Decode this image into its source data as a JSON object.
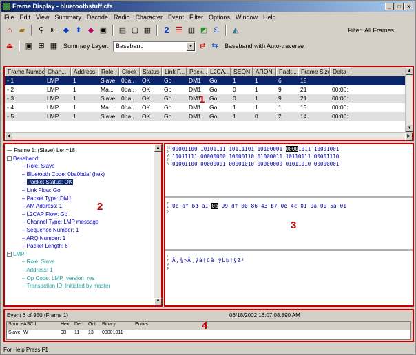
{
  "window": {
    "title": "Frame Display - bluetoothstuff.cfa",
    "min": "_",
    "max": "□",
    "close": "×"
  },
  "menu": [
    "File",
    "Edit",
    "View",
    "Summary",
    "Decode",
    "Radio",
    "Character",
    "Event",
    "Filter",
    "Options",
    "Window",
    "Help"
  ],
  "toolbar": {
    "filter_label": "Filter: All Frames",
    "summary_label": "Summary Layer:",
    "summary_value": "Baseband",
    "auto_label": "Baseband with Auto-traverse"
  },
  "summary": {
    "columns": [
      "Frame Number",
      "Chan...",
      "Address",
      "Role",
      "Clock",
      "Status",
      "Link F...",
      "Pack...",
      "L2CA...",
      "SEQN",
      "ARQN",
      "Pack...",
      "Frame Size",
      "Delta"
    ],
    "rows": [
      [
        "1",
        "LMP",
        "1",
        "Slave",
        "0ba..",
        "OK",
        "Go",
        "DM1",
        "Go",
        "1",
        "1",
        "6",
        "18",
        ""
      ],
      [
        "2",
        "LMP",
        "1",
        "Ma...",
        "0ba..",
        "OK",
        "Go",
        "DM1",
        "Go",
        "0",
        "1",
        "9",
        "21",
        "00:00:"
      ],
      [
        "3",
        "LMP",
        "1",
        "Slave",
        "0ba..",
        "OK",
        "Go",
        "DM1",
        "Go",
        "0",
        "1",
        "9",
        "21",
        "00:00:"
      ],
      [
        "4",
        "LMP",
        "1",
        "Ma...",
        "0ba..",
        "OK",
        "Go",
        "DM1",
        "Go",
        "1",
        "1",
        "1",
        "13",
        "00:00:"
      ],
      [
        "5",
        "LMP",
        "1",
        "Slave",
        "0ba..",
        "OK",
        "Go",
        "DM1",
        "Go",
        "1",
        "0",
        "2",
        "14",
        "00:00:"
      ]
    ]
  },
  "decode": {
    "frame": "Frame 1: (Slave) Len=18",
    "baseband": "Baseband:",
    "bb_items": [
      "Role: Slave",
      "Bluetooth Code: 0ba0bdaf (hex)",
      "Packet Status: OK",
      "Link Flow: Go",
      "Packet Type: DM1",
      "AM Address: 1",
      "L2CAP Flow: Go",
      "Channel Type: LMP message",
      "Sequence Number: 1",
      "ARQ Number: 1",
      "Packet Length: 6"
    ],
    "lmp": "LMP:",
    "lmp_items": [
      "Role: Slave",
      "Address: 1",
      "Op Code: LMP_version_res",
      "Transaction ID: Initiated by master"
    ]
  },
  "binary": {
    "lines": [
      [
        "00001100",
        "10101111",
        "10111101",
        "10100001",
        "0000",
        "1011",
        "10001001"
      ],
      [
        "11011111",
        "00000000",
        "10000110",
        "01000011",
        "10110111",
        "00001110"
      ],
      [
        "01001100",
        "00000001",
        "00001010",
        "00000000",
        "01011010",
        "00000001"
      ]
    ],
    "hex": [
      "0c",
      "af",
      "bd",
      "a1",
      "0b",
      "99",
      "df",
      "00",
      "86",
      "43",
      "b7",
      "0e",
      "4c",
      "01",
      "0a",
      "00",
      "5a",
      "01"
    ],
    "hex_highlight": "0b",
    "ascii": "Ä‚¾»Ã¸ÿà†Câ·ÿL‰†ÿZ¹"
  },
  "event": {
    "text": "Event 6 of 950 (Frame 1)",
    "time": "06/18/2002 16:07:08.890 AM"
  },
  "event_table": {
    "columns": [
      "Source",
      "ASCII",
      "Hex",
      "Dec",
      "Oct",
      "Binary",
      "Errors"
    ],
    "values": [
      "Slave",
      "W",
      "0B",
      "11",
      "13",
      "00001011",
      ""
    ]
  },
  "status": "For Help Press F1",
  "labels": {
    "n1": "1",
    "n2": "2",
    "n3": "3",
    "n4": "4"
  },
  "side_labels": {
    "bin": "B I N A R Y",
    "hex": "H E X",
    "ascii": "A S C I I",
    "char": "C H A R"
  }
}
